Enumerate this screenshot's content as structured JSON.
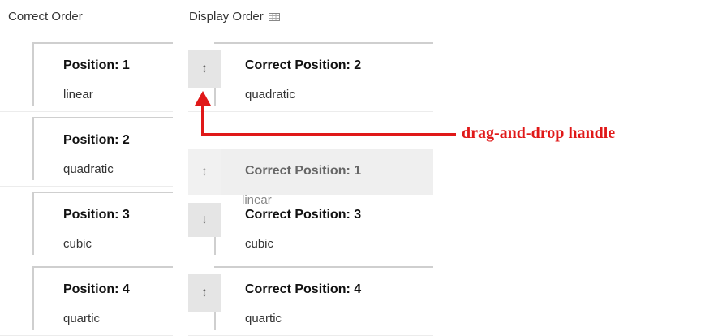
{
  "headers": {
    "correct_order": "Correct Order",
    "display_order": "Display Order",
    "display_order_icon": "grid-icon"
  },
  "correct_order": [
    {
      "title": "Position: 1",
      "label": "linear"
    },
    {
      "title": "Position: 2",
      "label": "quadratic"
    },
    {
      "title": "Position: 3",
      "label": "cubic"
    },
    {
      "title": "Position: 4",
      "label": "quartic"
    }
  ],
  "display_order": [
    {
      "title": "Correct Position: 2",
      "label": "quadratic",
      "handle_icon": "up-down-arrow-icon"
    },
    {
      "title": "Correct Position: 3",
      "label": "cubic",
      "handle_icon": "up-down-arrow-icon"
    },
    {
      "title": "Correct Position: 4",
      "label": "quartic",
      "handle_icon": "up-down-arrow-icon"
    }
  ],
  "dragging_item": {
    "title": "Correct Position: 1",
    "label": "linear",
    "handle_icon": "up-down-arrow-icon"
  },
  "annotation": {
    "text": "drag-and-drop handle",
    "color": "#e01818"
  },
  "glyphs": {
    "handle": "↕",
    "handle_short": "↓"
  }
}
